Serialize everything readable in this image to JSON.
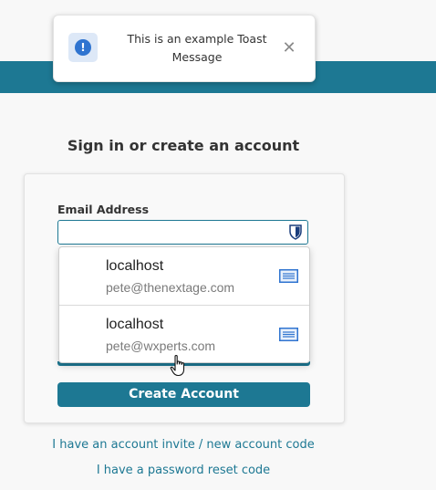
{
  "toast": {
    "icon": "exclamation-info-icon",
    "icon_glyph": "!",
    "message": "This is an example Toast Message",
    "close_glyph": "✕"
  },
  "signin": {
    "title": "Sign in or create an account",
    "email_label": "Email Address",
    "email_value": "",
    "create_account_label": "Create Account",
    "invite_link": "I have an account invite / new account code",
    "reset_link": "I have a password reset code"
  },
  "autofill": {
    "items": [
      {
        "host": "localhost",
        "username": "pete@thenextage.com"
      },
      {
        "host": "localhost",
        "username": "pete@wxperts.com"
      }
    ]
  },
  "colors": {
    "brand_teal": "#1d7893",
    "toast_icon_blue": "#2f74d0",
    "autofill_icon_blue": "#2f74d0"
  }
}
